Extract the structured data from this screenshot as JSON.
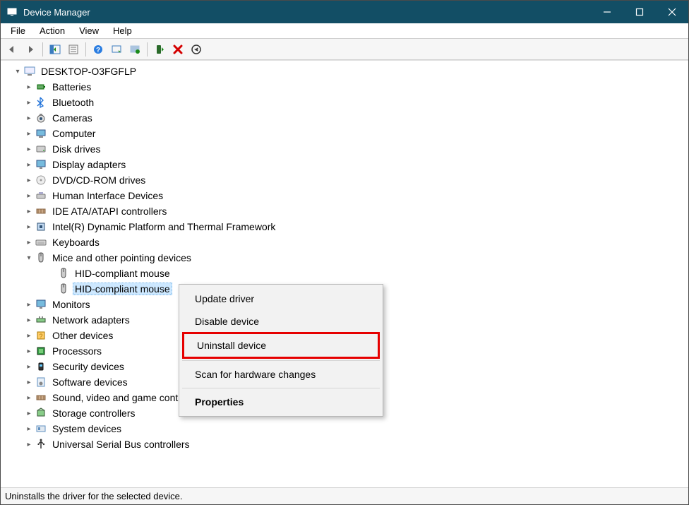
{
  "window": {
    "title": "Device Manager"
  },
  "menu": {
    "file": "File",
    "action": "Action",
    "view": "View",
    "help": "Help"
  },
  "tree": {
    "root": "DESKTOP-O3FGFLP",
    "categories": [
      {
        "label": "Batteries",
        "expanded": false
      },
      {
        "label": "Bluetooth",
        "expanded": false
      },
      {
        "label": "Cameras",
        "expanded": false
      },
      {
        "label": "Computer",
        "expanded": false
      },
      {
        "label": "Disk drives",
        "expanded": false
      },
      {
        "label": "Display adapters",
        "expanded": false
      },
      {
        "label": "DVD/CD-ROM drives",
        "expanded": false
      },
      {
        "label": "Human Interface Devices",
        "expanded": false
      },
      {
        "label": "IDE ATA/ATAPI controllers",
        "expanded": false
      },
      {
        "label": "Intel(R) Dynamic Platform and Thermal Framework",
        "expanded": false
      },
      {
        "label": "Keyboards",
        "expanded": false
      },
      {
        "label": "Mice and other pointing devices",
        "expanded": true,
        "children": [
          {
            "label": "HID-compliant mouse",
            "selected": false
          },
          {
            "label": "HID-compliant mouse",
            "selected": true
          }
        ]
      },
      {
        "label": "Monitors",
        "expanded": false
      },
      {
        "label": "Network adapters",
        "expanded": false
      },
      {
        "label": "Other devices",
        "expanded": false
      },
      {
        "label": "Processors",
        "expanded": false
      },
      {
        "label": "Security devices",
        "expanded": false
      },
      {
        "label": "Software devices",
        "expanded": false
      },
      {
        "label": "Sound, video and game controllers",
        "expanded": false
      },
      {
        "label": "Storage controllers",
        "expanded": false
      },
      {
        "label": "System devices",
        "expanded": false
      },
      {
        "label": "Universal Serial Bus controllers",
        "expanded": false
      }
    ]
  },
  "context_menu": {
    "update": "Update driver",
    "disable": "Disable device",
    "uninstall": "Uninstall device",
    "scan": "Scan for hardware changes",
    "properties": "Properties"
  },
  "statusbar": {
    "text": "Uninstalls the driver for the selected device."
  },
  "icons": {
    "root": "computer-icon",
    "battery": "battery-icon",
    "bluetooth": "bluetooth-icon",
    "camera": "camera-icon",
    "computer": "monitor-icon",
    "disk": "disk-icon",
    "display": "display-icon",
    "dvd": "optical-icon",
    "hid": "hid-icon",
    "ide": "ide-icon",
    "intel": "chip-icon",
    "keyboard": "keyboard-icon",
    "mouse": "mouse-icon",
    "monitor": "monitor-icon",
    "network": "network-icon",
    "other": "other-icon",
    "cpu": "cpu-icon",
    "security": "security-icon",
    "software": "software-icon",
    "sound": "sound-icon",
    "storage": "storage-icon",
    "system": "system-icon",
    "usb": "usb-icon"
  }
}
